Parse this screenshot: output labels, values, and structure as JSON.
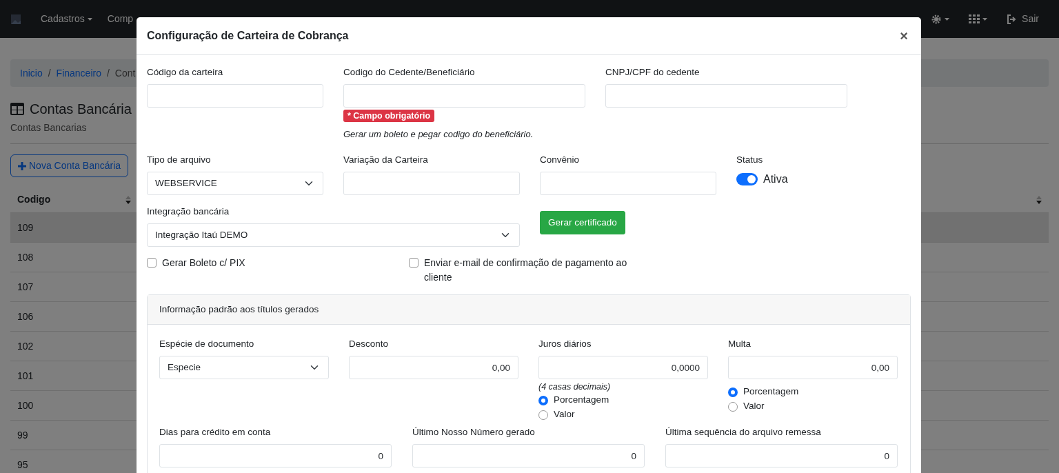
{
  "navbar": {
    "menus": [
      {
        "label": "Cadastros",
        "dropdown": true
      },
      {
        "label": "Comp",
        "dropdown": false
      }
    ],
    "logout": "Sair"
  },
  "page": {
    "breadcrumb": [
      {
        "kind": "link",
        "text": "Inicio"
      },
      {
        "kind": "separator",
        "text": "/"
      },
      {
        "kind": "link",
        "text": "Financeiro"
      },
      {
        "kind": "separator",
        "text": "/"
      },
      {
        "kind": "current",
        "text": "Cont"
      }
    ],
    "title": "Contas Bancária",
    "subtitle": "Contas Bancarias",
    "new_button": "Nova Conta Bancária",
    "table": {
      "columns": [
        "Codigo"
      ],
      "rows": [
        {
          "code": "109",
          "selected": true
        },
        {
          "code": "108",
          "selected": false
        },
        {
          "code": "107",
          "selected": false
        },
        {
          "code": "106",
          "selected": false
        },
        {
          "code": "102",
          "selected": false
        },
        {
          "code": "101",
          "selected": false
        },
        {
          "code": "100",
          "selected": false
        },
        {
          "code": "99",
          "selected": false
        },
        {
          "code": "95",
          "selected": false
        }
      ]
    }
  },
  "modal": {
    "title": "Configuração de Carteira de Cobrança",
    "close": "×",
    "rows": [
      [
        {
          "kind": "text",
          "label": "Código da carteira"
        },
        {
          "kind": "text",
          "label": "Codigo do Cedente/Beneficiário",
          "badge": "* Campo obrigatório",
          "help": "Gerar um boleto e pegar codigo do beneficiário."
        },
        {
          "kind": "text",
          "label": "CNPJ/CPF do cedente"
        }
      ],
      [
        {
          "kind": "select",
          "label": "Tipo de arquivo",
          "value": "WEBSERVICE"
        },
        {
          "kind": "text",
          "label": "Variação da Carteira"
        },
        {
          "kind": "text",
          "label": "Convênio"
        },
        {
          "kind": "switch",
          "label": "Status",
          "on": true,
          "text": "Ativa"
        }
      ],
      [
        {
          "kind": "select",
          "label": "Integração bancária",
          "value": "Integração Itaú DEMO"
        },
        {
          "kind": "button",
          "text": "Gerar certificado"
        }
      ]
    ],
    "checkboxes": [
      {
        "label": "Gerar Boleto c/ PIX",
        "checked": false
      },
      {
        "label": "Enviar e-mail de confirmação de pagamento ao cliente",
        "checked": false
      }
    ],
    "card": {
      "title": "Informação padrão aos títulos gerados",
      "rows": [
        [
          {
            "kind": "select",
            "label": "Espécie de documento",
            "value": "Especie"
          },
          {
            "kind": "number",
            "label": "Desconto",
            "value": "0,00"
          },
          {
            "kind": "number",
            "label": "Juros diários",
            "value": "0,0000",
            "note": "(4 casas decimais)",
            "options": [
              {
                "label": "Porcentagem",
                "selected": true
              },
              {
                "label": "Valor",
                "selected": false
              }
            ]
          },
          {
            "kind": "number",
            "label": "Multa",
            "value": "0,00",
            "options": [
              {
                "label": "Porcentagem",
                "selected": true
              },
              {
                "label": "Valor",
                "selected": false
              }
            ]
          }
        ],
        [
          {
            "kind": "number",
            "label": "Dias para crédito em conta",
            "value": "0"
          },
          {
            "kind": "number",
            "label": "Último Nosso Número gerado",
            "value": "0"
          },
          {
            "kind": "number",
            "label": "Última sequência do arquivo remessa",
            "value": "0"
          }
        ]
      ]
    }
  }
}
